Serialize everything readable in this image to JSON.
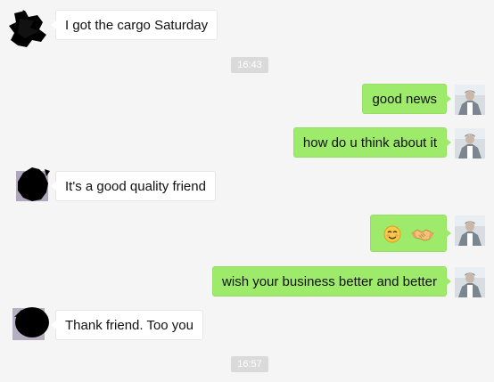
{
  "chat": {
    "messages": [
      {
        "side": "in",
        "text": "I got the cargo Saturday"
      },
      {
        "side": "out",
        "text": "good news"
      },
      {
        "side": "out",
        "text": "how do u think about it"
      },
      {
        "side": "in",
        "text": "It's a good quality friend"
      },
      {
        "side": "out",
        "emoji": [
          "smiling-face-icon",
          "handshake-icon"
        ]
      },
      {
        "side": "out",
        "text": "wish your business better and better"
      },
      {
        "side": "in",
        "text": "Thank friend. Too you"
      }
    ],
    "timestamps": [
      "16:43",
      "16:57"
    ]
  },
  "colors": {
    "background": "#f5f5f5",
    "outgoing_bubble": "#9eea6a",
    "incoming_bubble": "#ffffff",
    "timestamp_bg": "#dadada"
  }
}
